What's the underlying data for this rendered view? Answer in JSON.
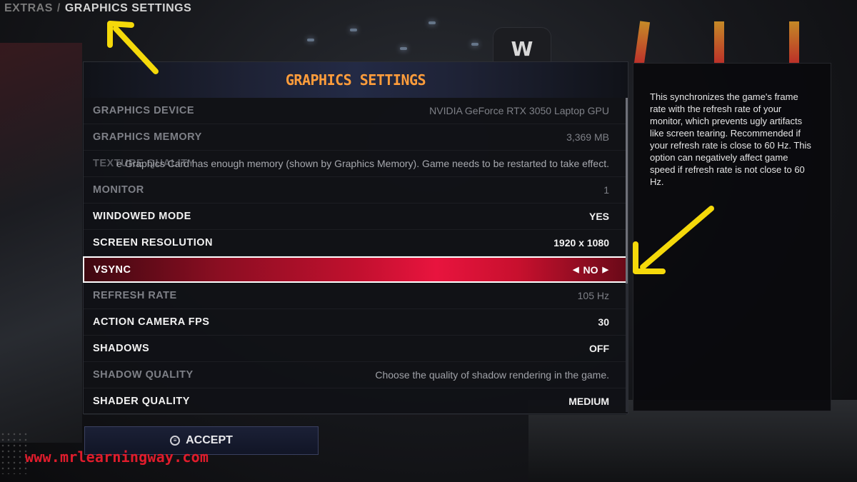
{
  "breadcrumb": {
    "parent": "EXTRAS",
    "separator": "/",
    "current": "GRAPHICS SETTINGS"
  },
  "panel": {
    "title": "GRAPHICS SETTINGS"
  },
  "settings": [
    {
      "label": "GRAPHICS DEVICE",
      "value": "NVIDIA GeForce RTX 3050 Laptop GPU",
      "state": "dim"
    },
    {
      "label": "GRAPHICS MEMORY",
      "value": "3,369 MB",
      "state": "dim"
    },
    {
      "label": "TEXTURE QUALITY",
      "value": "e Graphics Card has enough memory (shown by Graphics Memory). Game needs to be restarted to take effect.",
      "state": "hint"
    },
    {
      "label": "MONITOR",
      "value": "1",
      "state": "dim"
    },
    {
      "label": "WINDOWED MODE",
      "value": "YES",
      "state": "active"
    },
    {
      "label": "SCREEN RESOLUTION",
      "value": "1920 x 1080",
      "state": "active"
    },
    {
      "label": "VSYNC",
      "value": "NO",
      "state": "selected"
    },
    {
      "label": "REFRESH RATE",
      "value": "105 Hz",
      "state": "dim"
    },
    {
      "label": "ACTION CAMERA FPS",
      "value": "30",
      "state": "active"
    },
    {
      "label": "SHADOWS",
      "value": "OFF",
      "state": "active"
    },
    {
      "label": "SHADOW QUALITY",
      "value": "Choose the quality of shadow rendering in the game.",
      "state": "dim"
    },
    {
      "label": "SHADER QUALITY",
      "value": "MEDIUM",
      "state": "active"
    }
  ],
  "description": "This synchronizes the game's frame rate with the refresh rate of your monitor, which prevents ugly artifacts like screen tearing. Recommended if your refresh rate is close to 60 Hz. This option can negatively affect game speed if refresh rate is not close to 60 Hz.",
  "accept": {
    "label": "ACCEPT",
    "icon": "menu-circle-icon"
  },
  "watermark": "www.mrlearningway.com",
  "colors": {
    "accent_title": "#ff9d3b",
    "selected_row": "#c0102e",
    "annotation_arrow": "#f5d90a",
    "watermark": "#e01c2c"
  }
}
